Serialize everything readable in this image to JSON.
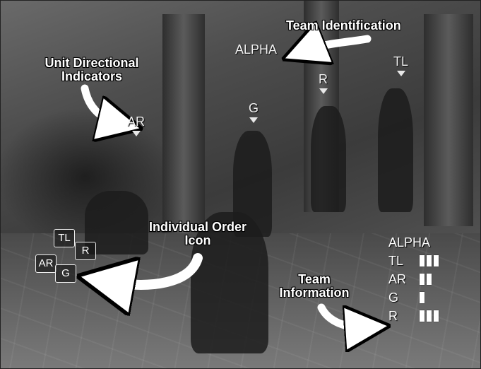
{
  "callouts": {
    "team_identification": "Team Identification",
    "unit_directional": "Unit Directional Indicators",
    "individual_order_icon": "Individual Order Icon",
    "team_information": "Team Information"
  },
  "unit_tags": {
    "team": "ALPHA",
    "rifleman": "R",
    "team_leader": "TL",
    "grenadier": "G",
    "auto_rifleman": "AR"
  },
  "order_icon_keys": [
    "TL",
    "R",
    "AR",
    "G"
  ],
  "roster": {
    "title": "ALPHA",
    "members": [
      {
        "label": "TL",
        "status_bars": 3
      },
      {
        "label": "AR",
        "status_bars": 2
      },
      {
        "label": "G",
        "status_bars": 1
      },
      {
        "label": "R",
        "status_bars": 3
      }
    ]
  },
  "colors": {
    "hud_text": "#ffffff",
    "indicator": "#e8e8e8"
  }
}
